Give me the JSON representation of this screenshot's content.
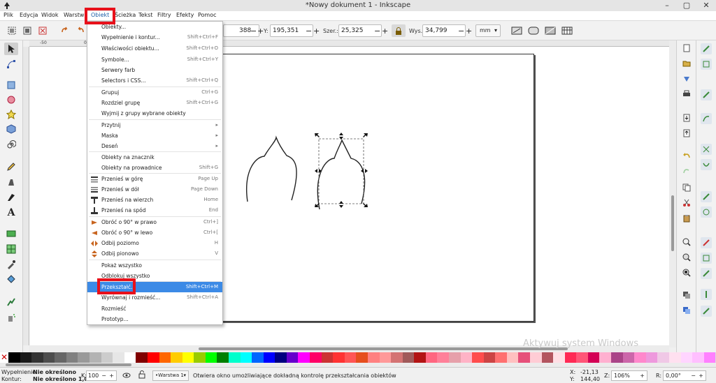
{
  "window": {
    "title": "*Nowy dokument 1 - Inkscape"
  },
  "menubar": [
    "Plik",
    "Edycja",
    "Widok",
    "Warstwa",
    "Obiekt",
    "Ścieżka",
    "Tekst",
    "Filtry",
    "Efekty",
    "Pomoc"
  ],
  "menubar_active": "Obiekt",
  "toolctrl": {
    "x_value": "388",
    "y_label": "Y:",
    "y_value": "195,351",
    "w_label": "Szer.:",
    "w_value": "25,325",
    "h_label": "Wys.:",
    "h_value": "34,799",
    "unit": "mm"
  },
  "ruler": {
    "top_ticks": [
      "-50",
      "0"
    ]
  },
  "menu": {
    "items": [
      {
        "label": "Obiekty...",
        "shortcut": ""
      },
      {
        "label": "Wypełnienie i kontur...",
        "shortcut": "Shift+Ctrl+F"
      },
      {
        "label": "Właściwości obiektu...",
        "shortcut": "Shift+Ctrl+O"
      },
      {
        "label": "Symbole...",
        "shortcut": "Shift+Ctrl+Y"
      },
      {
        "label": "Serwery farb",
        "shortcut": ""
      },
      {
        "label": "Selectors i CSS...",
        "shortcut": "Shift+Ctrl+Q"
      },
      {
        "label": "Grupuj",
        "shortcut": "Ctrl+G"
      },
      {
        "label": "Rozdziel grupę",
        "shortcut": "Shift+Ctrl+G"
      },
      {
        "label": "Wyjmij z grupy wybrane obiekty",
        "shortcut": ""
      },
      {
        "label": "Przytnij",
        "shortcut": "▸"
      },
      {
        "label": "Maska",
        "shortcut": "▸"
      },
      {
        "label": "Deseń",
        "shortcut": "▸"
      },
      {
        "label": "Obiekty na znacznik",
        "shortcut": ""
      },
      {
        "label": "Obiekty na prowadnice",
        "shortcut": "Shift+G"
      },
      {
        "label": "Przenieś w górę",
        "shortcut": "Page Up"
      },
      {
        "label": "Przenieś w dół",
        "shortcut": "Page Down"
      },
      {
        "label": "Przenieś na wierzch",
        "shortcut": "Home"
      },
      {
        "label": "Przenieś na spód",
        "shortcut": "End"
      },
      {
        "label": "Obróć o 90° w prawo",
        "shortcut": "Ctrl+]"
      },
      {
        "label": "Obróć o 90° w lewo",
        "shortcut": "Ctrl+["
      },
      {
        "label": "Odbij poziomo",
        "shortcut": "H"
      },
      {
        "label": "Odbij pionowo",
        "shortcut": "V"
      },
      {
        "label": "Pokaż wszystko",
        "shortcut": ""
      },
      {
        "label": "Odblokuj wszystko",
        "shortcut": ""
      },
      {
        "label": "Przekształć...",
        "shortcut": "Shift+Ctrl+M"
      },
      {
        "label": "Wyrównaj i rozmieść...",
        "shortcut": "Shift+Ctrl+A"
      },
      {
        "label": "Rozmieść",
        "shortcut": ""
      },
      {
        "label": "Prototyp...",
        "shortcut": ""
      }
    ],
    "highlighted": "Przekształć..."
  },
  "statusbar": {
    "fill_label": "Wypełnienie:",
    "fill_value": "Nie określono",
    "stroke_label": "Kontur:",
    "stroke_value": "Nie określono 1,00",
    "opacity_label": "K:",
    "opacity_value": "100",
    "layer": "•Warstwa 1",
    "message": "Otwiera okno umożliwiające dokładną kontrolę przekształcania obiektów",
    "x_label": "X:",
    "x_value": "-21,13",
    "y_label": "Y:",
    "y_value": "144,40",
    "z_label": "Z:",
    "zoom": "106%",
    "r_label": "R:",
    "rotation": "0,00°"
  },
  "watermark": "Aktywuj system Windows",
  "palette_colors": [
    "#000000",
    "#1a1a1a",
    "#333333",
    "#4d4d4d",
    "#666666",
    "#808080",
    "#999999",
    "#b3b3b3",
    "#cccccc",
    "#e6e6e6",
    "#ffffff",
    "#800000",
    "#ff0000",
    "#ff6600",
    "#ffcc00",
    "#ffff00",
    "#99cc00",
    "#00ff00",
    "#008000",
    "#00ffcc",
    "#00ffff",
    "#0066ff",
    "#0000ff",
    "#000080",
    "#6600cc",
    "#ff00ff",
    "#ff0066",
    "#cc3333",
    "#ff3333",
    "#ff5555",
    "#e64e1e",
    "#ff8080",
    "#ff9999",
    "#d47373",
    "#a05a5a",
    "#b31414",
    "#ff6680",
    "#ff8099",
    "#e6a0aa",
    "#ffb3c6",
    "#ff4d4d",
    "#cc4444",
    "#ff7070",
    "#ffc0c0",
    "#e6507a",
    "#ffccd5",
    "#b3555f",
    "#ffdfe5",
    "#ff2a55",
    "#ff5577",
    "#d40055",
    "#ffb0d0",
    "#aa4488",
    "#cc66aa",
    "#ff88cc",
    "#ee99dd",
    "#f0c8e6",
    "#ffe0f0",
    "#ffd5ff",
    "#ffbfff",
    "#ff80ff"
  ],
  "colors": {
    "menu_highlight": "#3c8ae6",
    "red_annotation": "#e8101a"
  }
}
